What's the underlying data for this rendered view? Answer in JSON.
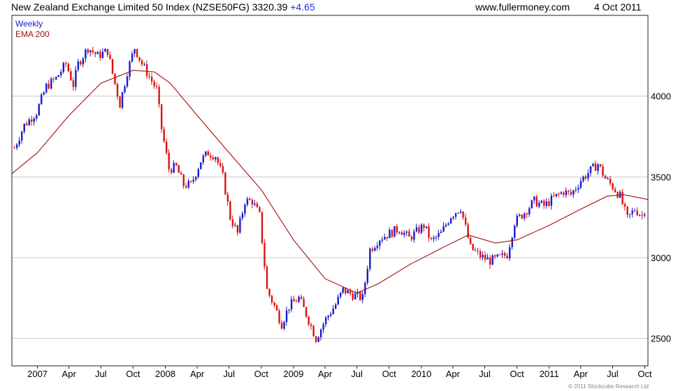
{
  "header": {
    "title": "New Zealand Exchange Limited 50 Index (NZSE50FG) 3320.39",
    "change": "+4.65",
    "site": "www.fullermoney.com",
    "date": "4 Oct 2011"
  },
  "copyright": "© 2011 Stockcube Research Ltd",
  "colors": {
    "up": "#1a1acc",
    "down": "#dd1111",
    "ema": "#a01010",
    "grid": "#c8c8c8",
    "frame": "#222222"
  },
  "chart_data": {
    "type": "line",
    "title": "New Zealand Exchange Limited 50 Index (NZSE50FG)",
    "ylim": [
      2330,
      4500
    ],
    "y_ticks": [
      2500,
      3000,
      3500,
      4000
    ],
    "x_range": [
      "2006-10-20",
      "2011-10-10"
    ],
    "x_ticks": [
      {
        "label": "2007",
        "date": "2007-01-01"
      },
      {
        "label": "Apr",
        "date": "2007-04-01"
      },
      {
        "label": "Jul",
        "date": "2007-07-01"
      },
      {
        "label": "Oct",
        "date": "2007-10-01"
      },
      {
        "label": "2008",
        "date": "2008-01-01"
      },
      {
        "label": "Apr",
        "date": "2008-04-01"
      },
      {
        "label": "Jul",
        "date": "2008-07-01"
      },
      {
        "label": "Oct",
        "date": "2008-10-01"
      },
      {
        "label": "2009",
        "date": "2009-01-01"
      },
      {
        "label": "Apr",
        "date": "2009-04-01"
      },
      {
        "label": "Jul",
        "date": "2009-07-01"
      },
      {
        "label": "Oct",
        "date": "2009-10-01"
      },
      {
        "label": "2010",
        "date": "2010-01-01"
      },
      {
        "label": "Apr",
        "date": "2010-04-01"
      },
      {
        "label": "Jul",
        "date": "2010-07-01"
      },
      {
        "label": "Oct",
        "date": "2010-10-01"
      },
      {
        "label": "2011",
        "date": "2011-01-01"
      },
      {
        "label": "Apr",
        "date": "2011-04-01"
      },
      {
        "label": "Jul",
        "date": "2011-07-01"
      },
      {
        "label": "Oct",
        "date": "2011-10-01"
      }
    ],
    "legend": [
      "Weekly",
      "EMA 200"
    ],
    "series": [
      {
        "name": "Weekly",
        "points": [
          [
            "2006-10-27",
            3680
          ],
          [
            "2006-11-24",
            3820
          ],
          [
            "2006-12-29",
            3900
          ],
          [
            "2007-01-26",
            4060
          ],
          [
            "2007-02-23",
            4110
          ],
          [
            "2007-03-23",
            4200
          ],
          [
            "2007-04-13",
            4070
          ],
          [
            "2007-04-27",
            4200
          ],
          [
            "2007-05-25",
            4300
          ],
          [
            "2007-06-22",
            4250
          ],
          [
            "2007-07-20",
            4280
          ],
          [
            "2007-08-03",
            4140
          ],
          [
            "2007-08-24",
            3950
          ],
          [
            "2007-09-14",
            4150
          ],
          [
            "2007-10-05",
            4300
          ],
          [
            "2007-10-26",
            4200
          ],
          [
            "2007-11-16",
            4120
          ],
          [
            "2007-12-07",
            4040
          ],
          [
            "2007-12-21",
            3800
          ],
          [
            "2008-01-11",
            3550
          ],
          [
            "2008-02-01",
            3560
          ],
          [
            "2008-02-22",
            3450
          ],
          [
            "2008-03-14",
            3450
          ],
          [
            "2008-04-11",
            3600
          ],
          [
            "2008-05-02",
            3650
          ],
          [
            "2008-05-23",
            3630
          ],
          [
            "2008-06-13",
            3500
          ],
          [
            "2008-07-04",
            3250
          ],
          [
            "2008-07-25",
            3150
          ],
          [
            "2008-08-15",
            3350
          ],
          [
            "2008-09-05",
            3350
          ],
          [
            "2008-09-26",
            3260
          ],
          [
            "2008-10-17",
            2800
          ],
          [
            "2008-11-07",
            2700
          ],
          [
            "2008-11-28",
            2590
          ],
          [
            "2008-12-19",
            2700
          ],
          [
            "2009-01-16",
            2750
          ],
          [
            "2009-02-06",
            2650
          ],
          [
            "2009-03-06",
            2500
          ],
          [
            "2009-04-03",
            2620
          ],
          [
            "2009-05-01",
            2710
          ],
          [
            "2009-05-22",
            2800
          ],
          [
            "2009-06-19",
            2770
          ],
          [
            "2009-07-17",
            2750
          ],
          [
            "2009-08-07",
            3050
          ],
          [
            "2009-09-04",
            3120
          ],
          [
            "2009-10-02",
            3150
          ],
          [
            "2009-10-30",
            3180
          ],
          [
            "2009-11-27",
            3120
          ],
          [
            "2010-01-08",
            3200
          ],
          [
            "2010-01-29",
            3100
          ],
          [
            "2010-02-26",
            3150
          ],
          [
            "2010-03-26",
            3260
          ],
          [
            "2010-04-23",
            3310
          ],
          [
            "2010-05-21",
            3060
          ],
          [
            "2010-06-18",
            3010
          ],
          [
            "2010-07-16",
            2980
          ],
          [
            "2010-08-13",
            3000
          ],
          [
            "2010-09-03",
            3020
          ],
          [
            "2010-09-24",
            3220
          ],
          [
            "2010-10-22",
            3280
          ],
          [
            "2010-11-19",
            3350
          ],
          [
            "2010-12-17",
            3320
          ],
          [
            "2011-01-14",
            3370
          ],
          [
            "2011-02-11",
            3410
          ],
          [
            "2011-03-04",
            3390
          ],
          [
            "2011-04-01",
            3480
          ],
          [
            "2011-04-29",
            3540
          ],
          [
            "2011-05-20",
            3580
          ],
          [
            "2011-06-10",
            3490
          ],
          [
            "2011-07-01",
            3440
          ],
          [
            "2011-07-22",
            3380
          ],
          [
            "2011-08-12",
            3240
          ],
          [
            "2011-09-02",
            3300
          ],
          [
            "2011-09-23",
            3260
          ],
          [
            "2011-10-04",
            3320
          ]
        ]
      },
      {
        "name": "EMA 200",
        "points": [
          [
            "2006-10-20",
            3520
          ],
          [
            "2007-01-01",
            3650
          ],
          [
            "2007-04-01",
            3880
          ],
          [
            "2007-07-01",
            4080
          ],
          [
            "2007-10-01",
            4160
          ],
          [
            "2007-12-01",
            4150
          ],
          [
            "2008-01-15",
            4080
          ],
          [
            "2008-04-01",
            3880
          ],
          [
            "2008-07-01",
            3650
          ],
          [
            "2008-10-01",
            3420
          ],
          [
            "2009-01-01",
            3110
          ],
          [
            "2009-04-01",
            2870
          ],
          [
            "2009-07-01",
            2780
          ],
          [
            "2009-09-01",
            2840
          ],
          [
            "2009-12-01",
            2960
          ],
          [
            "2010-03-01",
            3060
          ],
          [
            "2010-05-15",
            3140
          ],
          [
            "2010-08-01",
            3090
          ],
          [
            "2010-10-01",
            3110
          ],
          [
            "2011-01-01",
            3200
          ],
          [
            "2011-04-01",
            3300
          ],
          [
            "2011-06-15",
            3380
          ],
          [
            "2011-08-01",
            3390
          ],
          [
            "2011-10-10",
            3360
          ]
        ]
      }
    ]
  }
}
